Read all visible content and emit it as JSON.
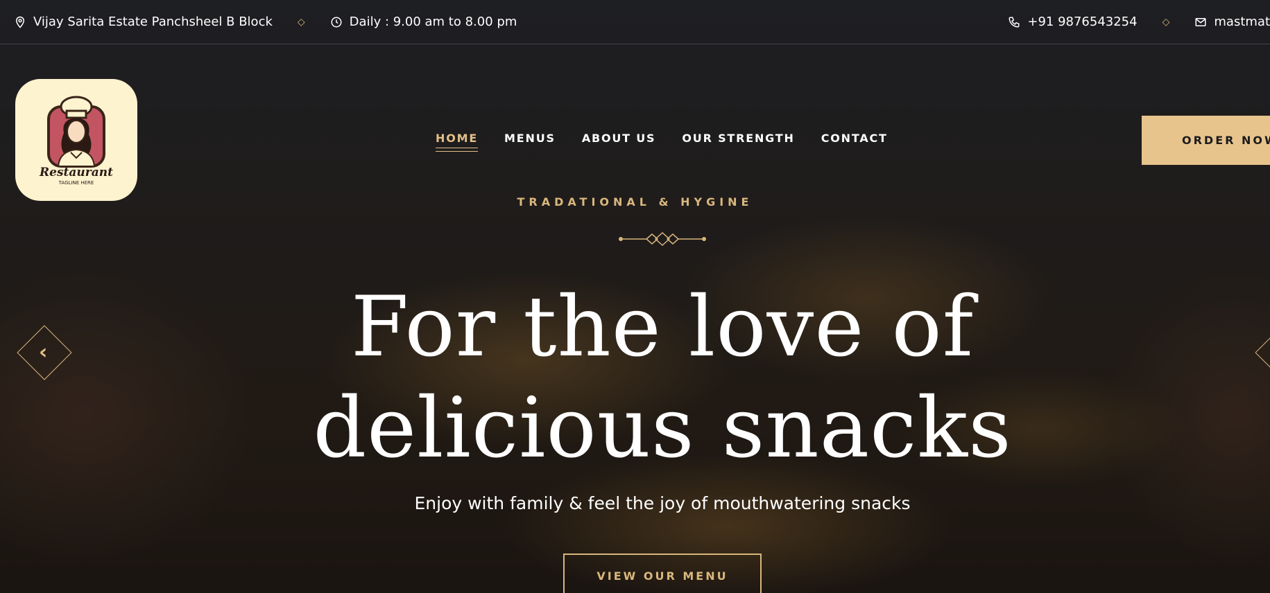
{
  "topbar": {
    "address": "Vijay Sarita Estate Panchsheel B Block",
    "hours": "Daily : 9.00 am to 8.00 pm",
    "phone": "+91 9876543254",
    "email": "mastmat"
  },
  "logo": {
    "name": "Restaurant",
    "tagline": "TAGLINE HERE"
  },
  "nav": {
    "items": [
      {
        "label": "HOME",
        "active": true
      },
      {
        "label": "MENUS",
        "active": false
      },
      {
        "label": "ABOUT US",
        "active": false
      },
      {
        "label": "OUR STRENGTH",
        "active": false
      },
      {
        "label": "CONTACT",
        "active": false
      }
    ],
    "order_label": "ORDER NOW"
  },
  "hero": {
    "kicker": "TRADATIONAL & HYGINE",
    "headline_line1": "For the love of",
    "headline_line2": "delicious snacks",
    "subline": "Enjoy with family & feel the joy of mouthwatering snacks",
    "cta_label": "VIEW OUR MENU"
  },
  "icons": {
    "address": "location-pin-icon",
    "hours": "clock-icon",
    "phone": "phone-icon",
    "email": "mail-icon",
    "prev": "chevron-left-icon",
    "next": "chevron-right-icon"
  },
  "colors": {
    "accent": "#d9b77d",
    "button_fill": "#e8c48d",
    "logo_bg": "#fdf3cf"
  }
}
